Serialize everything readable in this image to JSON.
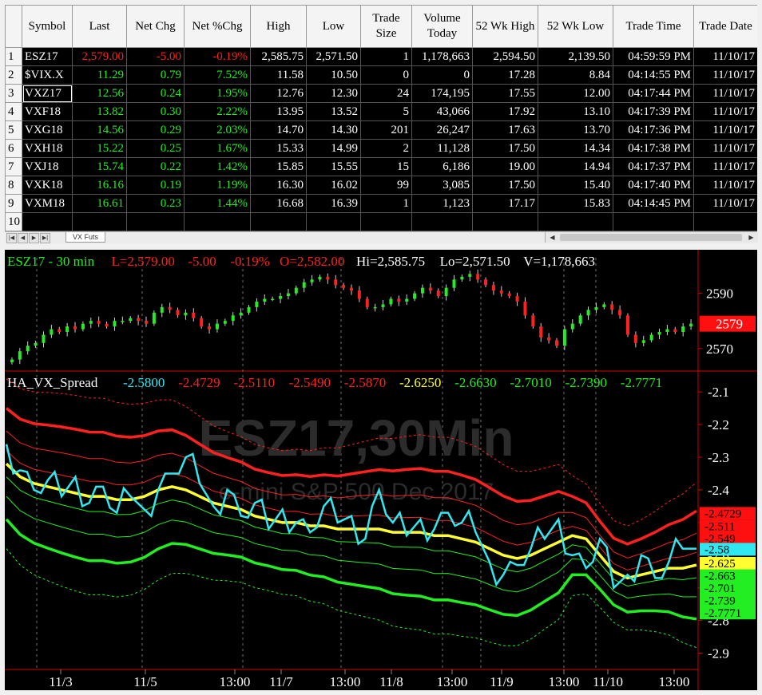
{
  "grid": {
    "columns": [
      "Symbol",
      "Last",
      "Net Chg",
      "Net %Chg",
      "High",
      "Low",
      "Trade Size",
      "Volume Today",
      "52 Wk High",
      "52 Wk Low",
      "Trade Time",
      "Trade Date"
    ],
    "rows": [
      {
        "n": "1",
        "symbol": "ESZ17",
        "last": "2,579.00",
        "net_chg": "-5.00",
        "net_pct": "-0.19%",
        "high": "2,585.75",
        "low": "2,571.50",
        "size": "1",
        "volume": "1,178,663",
        "wk_high": "2,594.50",
        "wk_low": "2,139.50",
        "time": "04:59:59 PM",
        "date": "11/10/17",
        "dir": "dn"
      },
      {
        "n": "2",
        "symbol": "$VIX.X",
        "last": "11.29",
        "net_chg": "0.79",
        "net_pct": "7.52%",
        "high": "11.58",
        "low": "10.50",
        "size": "0",
        "volume": "0",
        "wk_high": "17.28",
        "wk_low": "8.84",
        "time": "04:14:55 PM",
        "date": "11/10/17",
        "dir": "up"
      },
      {
        "n": "3",
        "symbol": "VXZ17",
        "last": "12.56",
        "net_chg": "0.24",
        "net_pct": "1.95%",
        "high": "12.76",
        "low": "12.30",
        "size": "24",
        "volume": "174,195",
        "wk_high": "17.55",
        "wk_low": "12.00",
        "time": "04:17:44 PM",
        "date": "11/10/17",
        "dir": "up"
      },
      {
        "n": "4",
        "symbol": "VXF18",
        "last": "13.82",
        "net_chg": "0.30",
        "net_pct": "2.22%",
        "high": "13.95",
        "low": "13.52",
        "size": "5",
        "volume": "43,066",
        "wk_high": "17.92",
        "wk_low": "13.10",
        "time": "04:17:39 PM",
        "date": "11/10/17",
        "dir": "up"
      },
      {
        "n": "5",
        "symbol": "VXG18",
        "last": "14.56",
        "net_chg": "0.29",
        "net_pct": "2.03%",
        "high": "14.70",
        "low": "14.30",
        "size": "201",
        "volume": "26,247",
        "wk_high": "17.63",
        "wk_low": "13.70",
        "time": "04:17:36 PM",
        "date": "11/10/17",
        "dir": "up"
      },
      {
        "n": "6",
        "symbol": "VXH18",
        "last": "15.22",
        "net_chg": "0.25",
        "net_pct": "1.67%",
        "high": "15.33",
        "low": "14.99",
        "size": "2",
        "volume": "11,128",
        "wk_high": "17.50",
        "wk_low": "14.34",
        "time": "04:17:38 PM",
        "date": "11/10/17",
        "dir": "up"
      },
      {
        "n": "7",
        "symbol": "VXJ18",
        "last": "15.74",
        "net_chg": "0.22",
        "net_pct": "1.42%",
        "high": "15.85",
        "low": "15.55",
        "size": "15",
        "volume": "6,186",
        "wk_high": "19.00",
        "wk_low": "14.94",
        "time": "04:17:37 PM",
        "date": "11/10/17",
        "dir": "up"
      },
      {
        "n": "8",
        "symbol": "VXK18",
        "last": "16.16",
        "net_chg": "0.19",
        "net_pct": "1.19%",
        "high": "16.30",
        "low": "16.02",
        "size": "99",
        "volume": "3,085",
        "wk_high": "17.50",
        "wk_low": "15.40",
        "time": "04:17:40 PM",
        "date": "11/10/17",
        "dir": "up"
      },
      {
        "n": "9",
        "symbol": "VXM18",
        "last": "16.61",
        "net_chg": "0.23",
        "net_pct": "1.44%",
        "high": "16.68",
        "low": "16.39",
        "size": "1",
        "volume": "1,123",
        "wk_high": "17.17",
        "wk_low": "15.83",
        "time": "04:14:45 PM",
        "date": "11/10/17",
        "dir": "up"
      },
      {
        "n": "10",
        "symbol": "",
        "last": "",
        "net_chg": "",
        "net_pct": "",
        "high": "",
        "low": "",
        "size": "",
        "volume": "",
        "wk_high": "",
        "wk_low": "",
        "time": "",
        "date": "",
        "dir": ""
      }
    ],
    "sheet_tab": "VX Futs",
    "nav_icons": [
      "first-icon",
      "prev-icon",
      "next-icon",
      "last-icon"
    ]
  },
  "chart_data": [
    {
      "type": "candlestick",
      "header": {
        "symbol": "ESZ17 - 30 min",
        "last": "L=2,579.00",
        "chg": "-5.00",
        "pct": "-0.19%",
        "open": "O=2,582.00",
        "hi": "Hi=2,585.75",
        "lo": "Lo=2,571.50",
        "vol": "V=1,178,663"
      },
      "ylim": [
        2563,
        2600
      ],
      "yticks": [
        "2590",
        "2570"
      ],
      "last_marker": "2579",
      "closes": [
        2566,
        2569,
        2571,
        2572,
        2575,
        2577,
        2576,
        2578,
        2577,
        2579,
        2580,
        2579,
        2578,
        2580,
        2580,
        2581,
        2580,
        2579,
        2583,
        2585,
        2584,
        2582,
        2583,
        2581,
        2578,
        2577,
        2579,
        2580,
        2582,
        2583,
        2585,
        2587,
        2588,
        2588,
        2589,
        2590,
        2592,
        2594,
        2595,
        2596,
        2595,
        2593,
        2592,
        2591,
        2588,
        2585,
        2585,
        2586,
        2588,
        2587,
        2588,
        2590,
        2592,
        2591,
        2589,
        2592,
        2595,
        2596,
        2597,
        2595,
        2593,
        2591,
        2590,
        2589,
        2587,
        2582,
        2578,
        2574,
        2573,
        2571,
        2577,
        2579,
        2582,
        2584,
        2585,
        2586,
        2584,
        2582,
        2575,
        2572,
        2573,
        2575,
        2576,
        2577,
        2576,
        2578,
        2579
      ],
      "xticks": [
        "11/3",
        "11/5",
        "13:00",
        "11/7",
        "13:00",
        "11/8",
        "13:00",
        "11/9",
        "13:00",
        "11/10",
        "13:00"
      ],
      "watermark": "ESZ17,30Min",
      "watermark_sub": "e-mini S&P 500 Dec 2017"
    },
    {
      "type": "line",
      "name": "HA_VX_Spread",
      "ylim": [
        -2.95,
        -2.08
      ],
      "yticks": [
        "-2.1",
        "-2.2",
        "-2.3",
        "-2.4",
        "-2.5",
        "-2.6",
        "-2.7",
        "-2.8",
        "-2.9"
      ],
      "header_values": [
        {
          "v": "-2.5800",
          "c": "#30e8f0"
        },
        {
          "v": "-2.4729",
          "c": "#ff2020"
        },
        {
          "v": "-2.5110",
          "c": "#ff2020"
        },
        {
          "v": "-2.5490",
          "c": "#ff2020"
        },
        {
          "v": "-2.5870",
          "c": "#ff2020"
        },
        {
          "v": "-2.6250",
          "c": "#ffff30"
        },
        {
          "v": "-2.6630",
          "c": "#22ee22"
        },
        {
          "v": "-2.7010",
          "c": "#22ee22"
        },
        {
          "v": "-2.7390",
          "c": "#22ee22"
        },
        {
          "v": "-2.7771",
          "c": "#22ee22"
        }
      ],
      "axis_markers": [
        {
          "v": "-2.4729",
          "c": "#ff1010",
          "y": -2.472
        },
        {
          "v": "-2.511",
          "c": "#ff1010",
          "y": -2.511
        },
        {
          "v": "-2.549",
          "c": "#ff1010",
          "y": -2.549
        },
        {
          "v": "-2.58",
          "c": "#30e8f0",
          "y": -2.582
        },
        {
          "v": "-2.625",
          "c": "#ffff30",
          "y": -2.625
        },
        {
          "v": "-2.663",
          "c": "#22ee22",
          "y": -2.663
        },
        {
          "v": "-2.701",
          "c": "#22ee22",
          "y": -2.701
        },
        {
          "v": "-2.739",
          "c": "#22ee22",
          "y": -2.739
        },
        {
          "v": "-2.7771",
          "c": "#22ee22",
          "y": -2.777
        }
      ],
      "mid": [
        -2.32,
        -2.36,
        -2.38,
        -2.39,
        -2.4,
        -2.41,
        -2.42,
        -2.42,
        -2.43,
        -2.43,
        -2.42,
        -2.4,
        -2.39,
        -2.4,
        -2.42,
        -2.44,
        -2.45,
        -2.46,
        -2.48,
        -2.49,
        -2.5,
        -2.5,
        -2.51,
        -2.51,
        -2.52,
        -2.52,
        -2.52,
        -2.52,
        -2.53,
        -2.53,
        -2.53,
        -2.54,
        -2.54,
        -2.55,
        -2.56,
        -2.58,
        -2.6,
        -2.61,
        -2.6,
        -2.58,
        -2.56,
        -2.54,
        -2.55,
        -2.6,
        -2.65,
        -2.67,
        -2.66,
        -2.65,
        -2.64,
        -2.64,
        -2.63
      ],
      "spread": [
        -2.26,
        -2.34,
        -2.4,
        -2.37,
        -2.42,
        -2.36,
        -2.44,
        -2.39,
        -2.47,
        -2.42,
        -2.46,
        -2.4,
        -2.35,
        -2.3,
        -2.38,
        -2.45,
        -2.4,
        -2.48,
        -2.44,
        -2.52,
        -2.46,
        -2.5,
        -2.53,
        -2.45,
        -2.5,
        -2.48,
        -2.55,
        -2.4,
        -2.5,
        -2.54,
        -2.49,
        -2.52,
        -2.47,
        -2.5,
        -2.53,
        -2.62,
        -2.66,
        -2.63,
        -2.58,
        -2.55,
        -2.49,
        -2.6,
        -2.64,
        -2.55,
        -2.7,
        -2.66,
        -2.6,
        -2.67,
        -2.62,
        -2.58,
        -2.58
      ],
      "band_offsets": [
        0.26,
        0.17,
        0.1,
        0.04,
        -0.04,
        -0.1,
        -0.17,
        -0.26
      ]
    }
  ]
}
